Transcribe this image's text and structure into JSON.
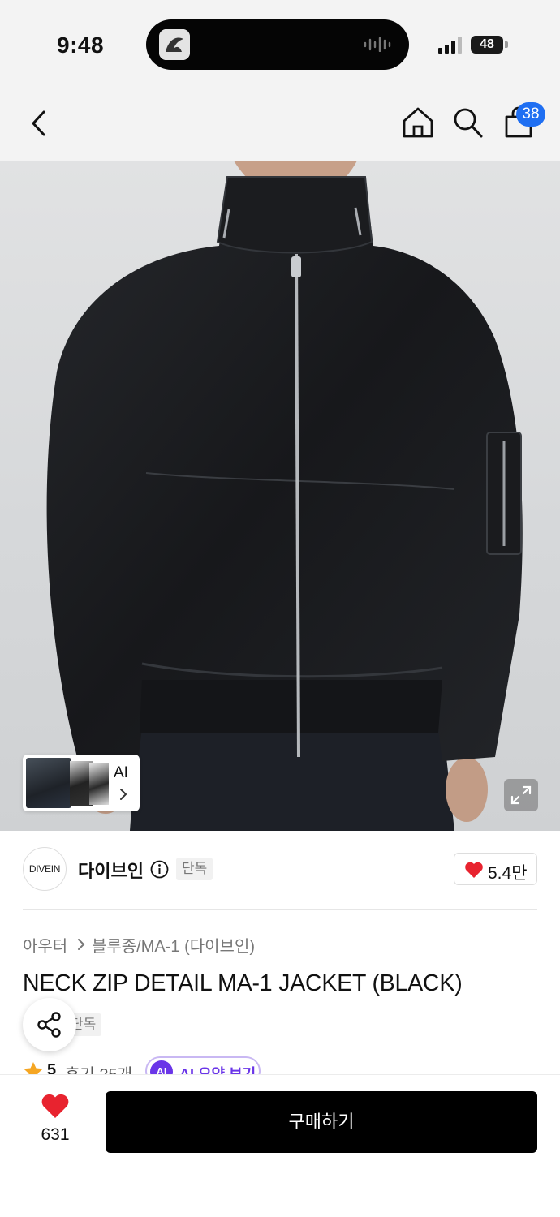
{
  "status_bar": {
    "time": "9:48",
    "battery": "48"
  },
  "nav": {
    "cart_count": "38"
  },
  "product_image": {
    "thumbnail_label": "AI"
  },
  "brand": {
    "logo_text": "DIVEIN",
    "name": "다이브인",
    "tag": "단독",
    "likes": "5.4만"
  },
  "breadcrumb": {
    "parent": "아우터",
    "child": "블루종/MA-1 (다이브인)"
  },
  "product": {
    "title": "NECK ZIP DETAIL MA-1 JACKET (BLACK)",
    "tag": "단독",
    "rating": "5",
    "reviews": "후기 25개",
    "ai_summary_badge": "AI",
    "ai_summary_label": "AI 요약 보기"
  },
  "bottom_bar": {
    "wish_count": "631",
    "buy_label": "구매하기"
  },
  "colors": {
    "accent_blue": "#1f6ff2",
    "heart_red": "#e8232f",
    "ai_purple": "#6a35e8",
    "star_orange": "#f5a623"
  }
}
